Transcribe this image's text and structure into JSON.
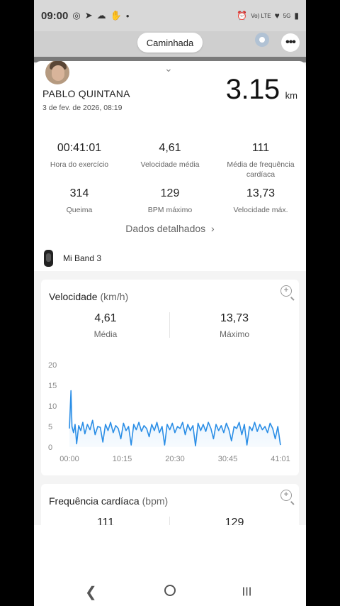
{
  "statusbar": {
    "time": "09:00",
    "network": "Vo) LTE",
    "signal_label": "5G"
  },
  "header": {
    "activity_mode": "Caminhada"
  },
  "summary": {
    "user_name": "PABLO QUINTANA",
    "date": "3 de fev. de 2026, 08:19",
    "distance_value": "3.15",
    "distance_unit": "km",
    "stats_row1": [
      {
        "value": "00:41:01",
        "label": "Hora do exercício"
      },
      {
        "value": "4,61",
        "label": "Velocidade média"
      },
      {
        "value": "111",
        "label": "Média de frequência cardíaca"
      }
    ],
    "stats_row2": [
      {
        "value": "314",
        "label": "Queima"
      },
      {
        "value": "129",
        "label": "BPM máximo"
      },
      {
        "value": "13,73",
        "label": "Velocidade máx."
      }
    ],
    "details_link": "Dados detalhados",
    "device_name": "Mi Band 3"
  },
  "speed_card": {
    "title": "Velocidade",
    "unit": "(km/h)",
    "avg_value": "4,61",
    "avg_label": "Média",
    "max_value": "13,73",
    "max_label": "Máximo"
  },
  "hr_card": {
    "title": "Frequência cardíaca",
    "unit": "(bpm)",
    "avg_value": "111",
    "max_value": "129"
  },
  "colors": {
    "line": "#2b8ee6",
    "fill": "#d6eafb"
  },
  "chart_data": {
    "type": "area",
    "title": "",
    "xlabel": "",
    "ylabel": "",
    "x_ticks": [
      "00:00",
      "10:15",
      "20:30",
      "30:45",
      "41:01"
    ],
    "y_ticks": [
      0,
      5,
      10,
      15,
      20
    ],
    "ylim": [
      0,
      20
    ],
    "xlim_minutes": [
      0,
      41.02
    ],
    "grid": false,
    "series": [
      {
        "name": "",
        "x_minutes": [
          0,
          0.3,
          0.5,
          0.8,
          1.1,
          1.4,
          1.8,
          2.2,
          2.6,
          3.0,
          3.5,
          4.0,
          4.5,
          5.0,
          5.5,
          6.0,
          6.5,
          7.0,
          7.5,
          8.0,
          8.5,
          9.0,
          9.5,
          10.0,
          10.5,
          11.0,
          11.5,
          12.0,
          12.5,
          13.0,
          13.5,
          14.0,
          14.5,
          15.0,
          15.5,
          16.0,
          16.5,
          17.0,
          17.5,
          18.0,
          18.5,
          19.0,
          19.5,
          20.0,
          20.5,
          21.0,
          21.5,
          22.0,
          22.5,
          23.0,
          23.5,
          24.0,
          24.5,
          25.0,
          25.5,
          26.0,
          26.5,
          27.0,
          27.5,
          28.0,
          28.5,
          29.0,
          29.5,
          30.0,
          30.5,
          31.0,
          31.5,
          32.0,
          32.5,
          33.0,
          33.5,
          34.0,
          34.5,
          35.0,
          35.5,
          36.0,
          36.5,
          37.0,
          37.5,
          38.0,
          38.5,
          39.0,
          39.5,
          40.0,
          40.5,
          41.0
        ],
        "values": [
          4.5,
          13.7,
          5.0,
          3.5,
          5.5,
          0.8,
          5.2,
          4.0,
          6.0,
          3.2,
          5.5,
          4.2,
          6.5,
          3.0,
          5.0,
          4.8,
          1.2,
          5.5,
          4.0,
          6.0,
          3.5,
          5.2,
          4.5,
          2.0,
          5.8,
          4.0,
          5.0,
          0.5,
          5.5,
          4.2,
          6.0,
          3.8,
          5.2,
          4.5,
          2.5,
          5.5,
          4.0,
          6.0,
          3.5,
          5.0,
          0.5,
          5.5,
          4.2,
          5.8,
          3.5,
          5.0,
          4.5,
          6.0,
          3.0,
          5.5,
          4.0,
          5.2,
          0.3,
          5.8,
          4.0,
          5.5,
          3.8,
          6.0,
          4.5,
          2.0,
          5.5,
          4.0,
          5.2,
          3.5,
          5.8,
          4.2,
          1.5,
          5.0,
          4.5,
          6.0,
          3.0,
          5.5,
          0.5,
          5.0,
          4.0,
          6.0,
          3.8,
          5.5,
          4.2,
          5.0,
          3.5,
          5.8,
          4.5,
          2.0,
          5.0,
          0.5
        ]
      }
    ]
  }
}
